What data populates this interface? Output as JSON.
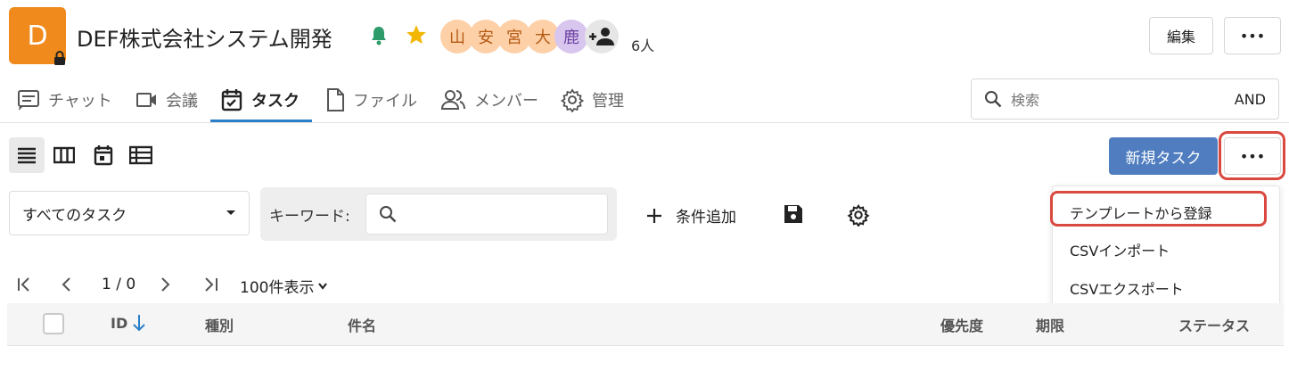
{
  "project": {
    "icon_letter": "D",
    "icon_color": "#f08a1c",
    "title": "DEF株式会社システム開発",
    "members": [
      "山",
      "安",
      "宮",
      "大",
      "鹿"
    ],
    "member_count": "6人"
  },
  "header": {
    "edit_label": "編集",
    "more_label": "•••"
  },
  "tabs": [
    {
      "label": "チャット",
      "icon": "chat-icon"
    },
    {
      "label": "会議",
      "icon": "video-icon"
    },
    {
      "label": "タスク",
      "icon": "task-icon",
      "active": true
    },
    {
      "label": "ファイル",
      "icon": "file-icon"
    },
    {
      "label": "メンバー",
      "icon": "members-icon"
    },
    {
      "label": "管理",
      "icon": "settings-icon"
    }
  ],
  "search": {
    "placeholder": "検索",
    "mode": "AND"
  },
  "toolbar": {
    "new_task_label": "新規タスク",
    "more_label": "•••",
    "accent": "#4f7dbf"
  },
  "filter": {
    "selected": "すべてのタスク",
    "keyword_label": "キーワード:",
    "keyword_value": "",
    "add_condition_label": "条件追加"
  },
  "menu": {
    "items": [
      "テンプレートから登録",
      "CSVインポート",
      "CSVエクスポート"
    ]
  },
  "pagination": {
    "page": "1 / 0",
    "per_page": "100件表示"
  },
  "table": {
    "columns": [
      "ID",
      "種別",
      "件名",
      "優先度",
      "期限",
      "ステータス"
    ]
  },
  "highlight_color": "#d9493f"
}
